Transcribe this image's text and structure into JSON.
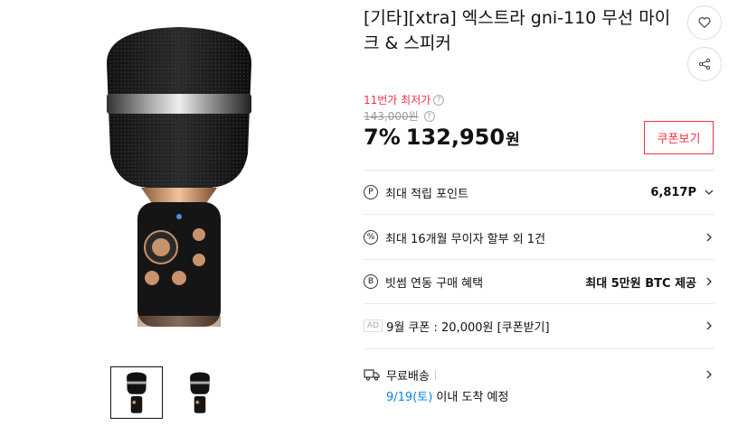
{
  "product": {
    "title": "[기타][xtra] 엑스트라 gni-110 무선 마이크 & 스피커",
    "lowest_label": "11번가 최저가",
    "original_price": "143,000원",
    "discount": "7%",
    "price": "132,950",
    "currency": "원",
    "coupon_button": "쿠폰보기"
  },
  "benefits": {
    "points": {
      "label": "최대 적립 포인트",
      "value": "6,817P",
      "icon": "P"
    },
    "installment": {
      "label": "최대 16개월 무이자 할부 외 1건",
      "icon": "%"
    },
    "bitsum": {
      "label": "빗썸 연동 구매 혜택",
      "value": "최대 5만원 BTC 제공",
      "icon": "B"
    },
    "coupon": {
      "ad": "AD",
      "label": "9월 쿠폰 : 20,000원 [쿠폰받기]"
    },
    "shipping": {
      "label": "무료배송",
      "date": "9/19(토)",
      "date_rest": " 이내 도착 예정"
    }
  },
  "colors": {
    "accent": "#f43142",
    "link": "#0b83e6"
  }
}
